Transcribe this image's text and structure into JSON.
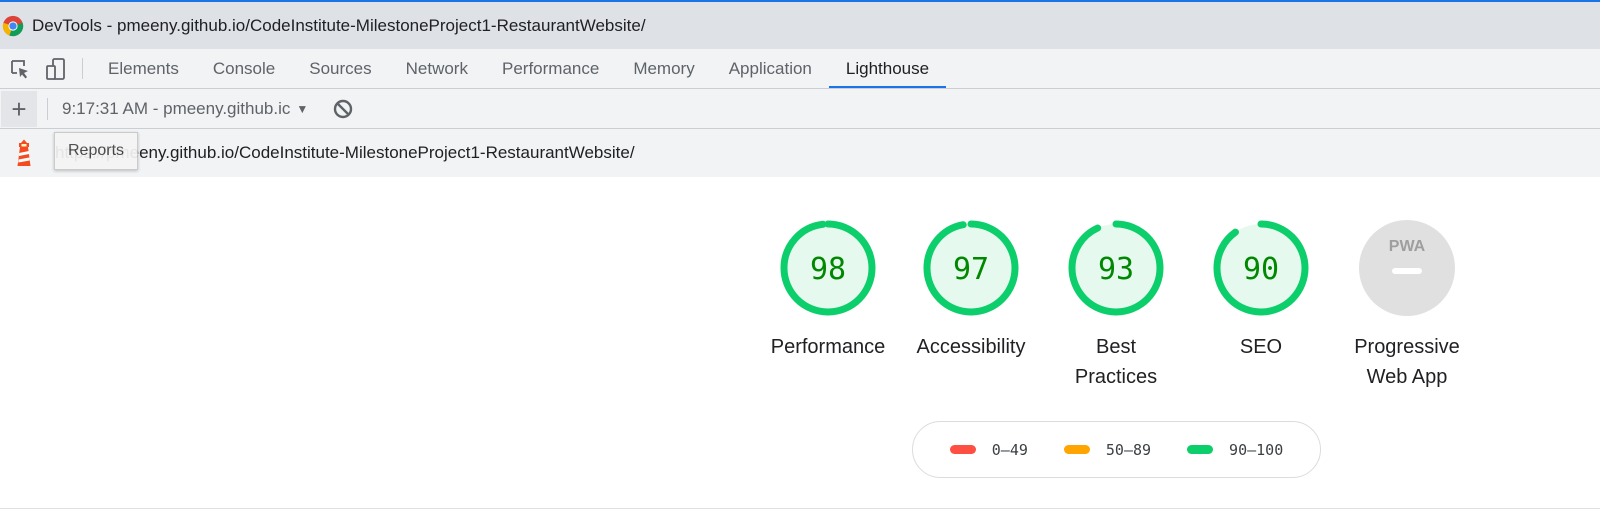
{
  "window": {
    "title": "DevTools - pmeeny.github.io/CodeInstitute-MilestoneProject1-RestaurantWebsite/"
  },
  "tabs": [
    {
      "label": "Elements",
      "active": false
    },
    {
      "label": "Console",
      "active": false
    },
    {
      "label": "Sources",
      "active": false
    },
    {
      "label": "Network",
      "active": false
    },
    {
      "label": "Performance",
      "active": false
    },
    {
      "label": "Memory",
      "active": false
    },
    {
      "label": "Application",
      "active": false
    },
    {
      "label": "Lighthouse",
      "active": true
    }
  ],
  "toolbar": {
    "add_label": "+",
    "report_select": "9:17:31 AM - pmeeny.github.ic",
    "clear_icon": "block-icon"
  },
  "urlbar": {
    "url": "https://pmeeny.github.io/CodeInstitute-MilestoneProject1-RestaurantWebsite/",
    "tooltip": "Reports",
    "logo_icon": "lighthouse-icon"
  },
  "scores": [
    {
      "value": 98,
      "label_lines": [
        "Performance"
      ]
    },
    {
      "value": 97,
      "label_lines": [
        "Accessibility"
      ]
    },
    {
      "value": 93,
      "label_lines": [
        "Best",
        "Practices"
      ]
    },
    {
      "value": 90,
      "label_lines": [
        "SEO"
      ]
    }
  ],
  "pwa": {
    "badge": "PWA",
    "label_lines": [
      "Progressive",
      "Web App"
    ]
  },
  "legend": [
    {
      "range": "0–49",
      "color": "#ff4e42"
    },
    {
      "range": "50–89",
      "color": "#ffa400"
    },
    {
      "range": "90–100",
      "color": "#0cce6b"
    }
  ],
  "colors": {
    "pass": "#0cce6b",
    "pass_fill": "#e5f9ee",
    "pass_text": "#008800",
    "accent": "#1a73e8"
  }
}
